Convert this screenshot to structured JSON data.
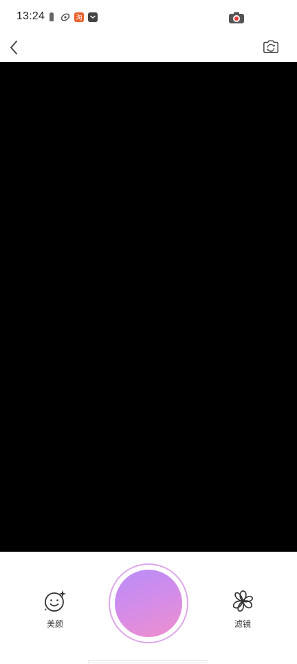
{
  "status_bar": {
    "time": "13:24",
    "icons": [
      "battery-saver-icon",
      "app-notification-icon",
      "taobao-notification-icon",
      "message-notification-icon"
    ],
    "recording_icon": "screen-record-icon"
  },
  "top_bar": {
    "back_icon": "chevron-left-icon",
    "switch_camera_icon": "switch-camera-icon"
  },
  "camera": {
    "preview_color": "#000000"
  },
  "controls": {
    "beauty_label": "美颜",
    "beauty_icon": "beauty-face-icon",
    "filter_label": "滤镜",
    "filter_icon": "filter-flower-icon",
    "shutter_gradient": [
      "#b88df8",
      "#f08fcd"
    ],
    "shutter_ring_color": "#dda6ea"
  }
}
